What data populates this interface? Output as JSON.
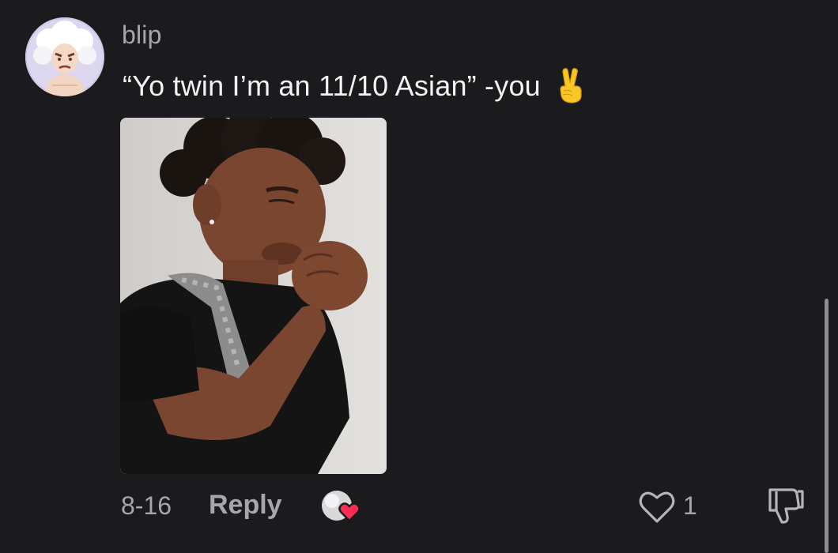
{
  "comment": {
    "username": "blip",
    "text": "“Yo twin I’m an 11/10 Asian” -you",
    "emoji": "victory-hand-emoji",
    "date": "8-16",
    "reply_label": "Reply",
    "like_count": "1"
  },
  "icons": {
    "like": "heart-outline-icon",
    "dislike": "thumbs-down-icon",
    "creator_liked": "creator-liked-heart-icon"
  },
  "colors": {
    "background": "#1b1b1d",
    "primary_text": "#f2f2f4",
    "secondary_text": "#a7a7ab",
    "heart_accent": "#fe2c55"
  }
}
